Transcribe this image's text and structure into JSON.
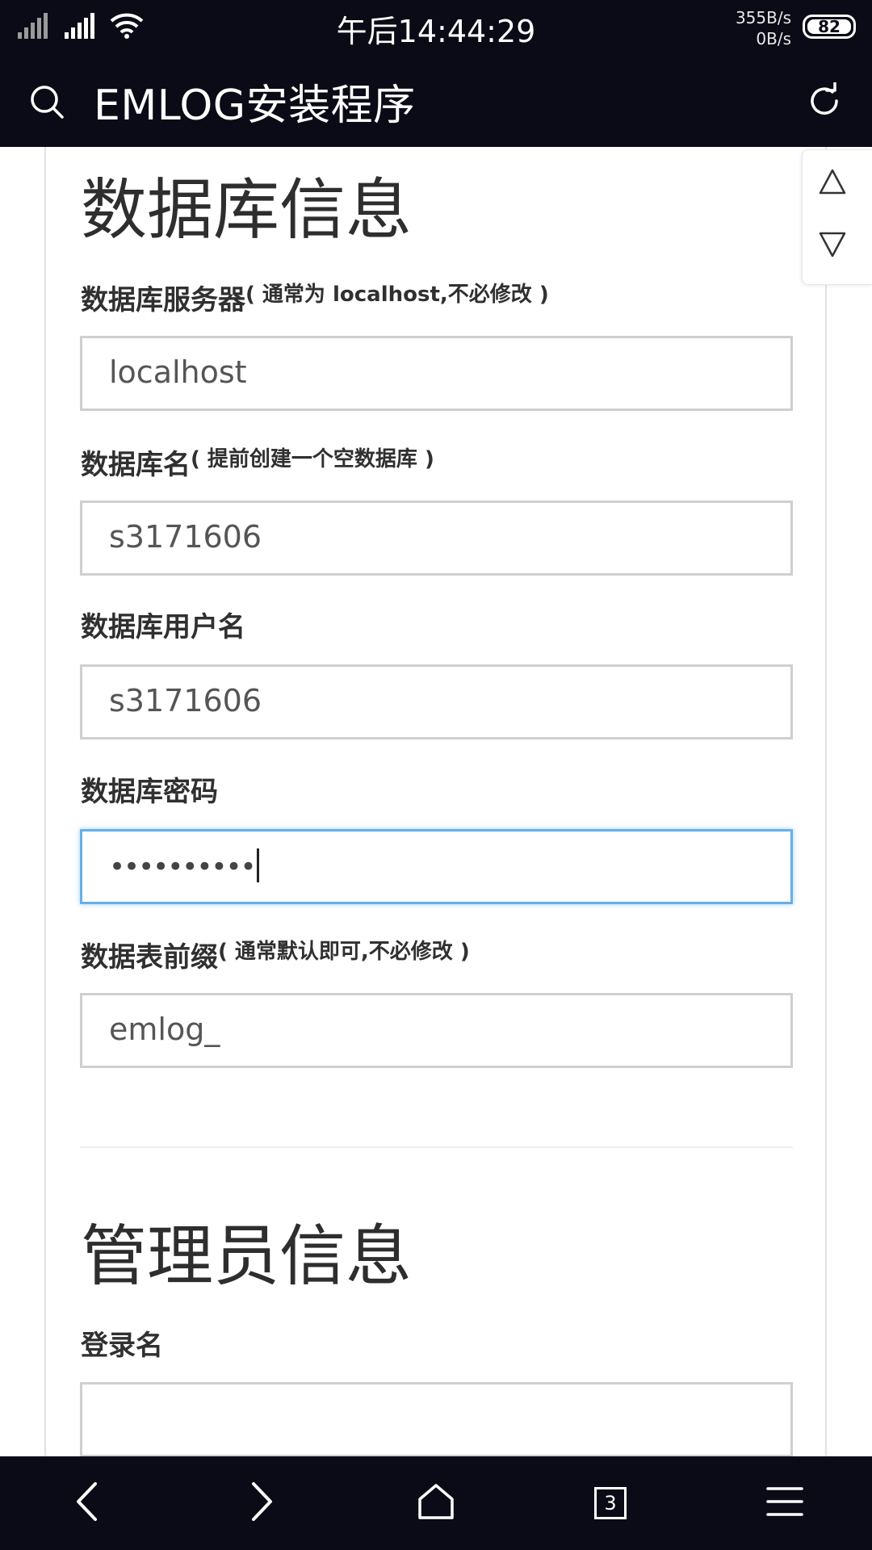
{
  "status_bar": {
    "time": "午后14:44:29",
    "net_speed_up": "355B/s",
    "net_speed_down": "0B/s",
    "battery": "82"
  },
  "title_bar": {
    "title": "EMLOG安装程序",
    "search_icon": "search-icon",
    "reload_icon": "reload-icon"
  },
  "db_section": {
    "heading": "数据库信息",
    "fields": [
      {
        "label": "数据库服务器",
        "hint": "( 通常为 localhost,不必修改 )",
        "value": "localhost"
      },
      {
        "label": "数据库名",
        "hint": "( 提前创建一个空数据库 )",
        "value": "s3171606"
      },
      {
        "label": "数据库用户名",
        "hint": "",
        "value": "s3171606"
      },
      {
        "label": "数据库密码",
        "hint": "",
        "value": "••••••••••"
      },
      {
        "label": "数据表前缀",
        "hint": "( 通常默认即可,不必修改 )",
        "value": "emlog_"
      }
    ]
  },
  "admin_section": {
    "heading": "管理员信息",
    "fields": [
      {
        "label": "登录名",
        "value": ""
      }
    ]
  },
  "bottom_nav": {
    "tab_count": "3",
    "icons": [
      "back-icon",
      "forward-icon",
      "home-icon",
      "tabs-icon",
      "menu-icon"
    ]
  },
  "colors": {
    "bar_background": "#0b0b17",
    "focus_border": "#66afe9",
    "input_border": "#cfcfcf"
  }
}
